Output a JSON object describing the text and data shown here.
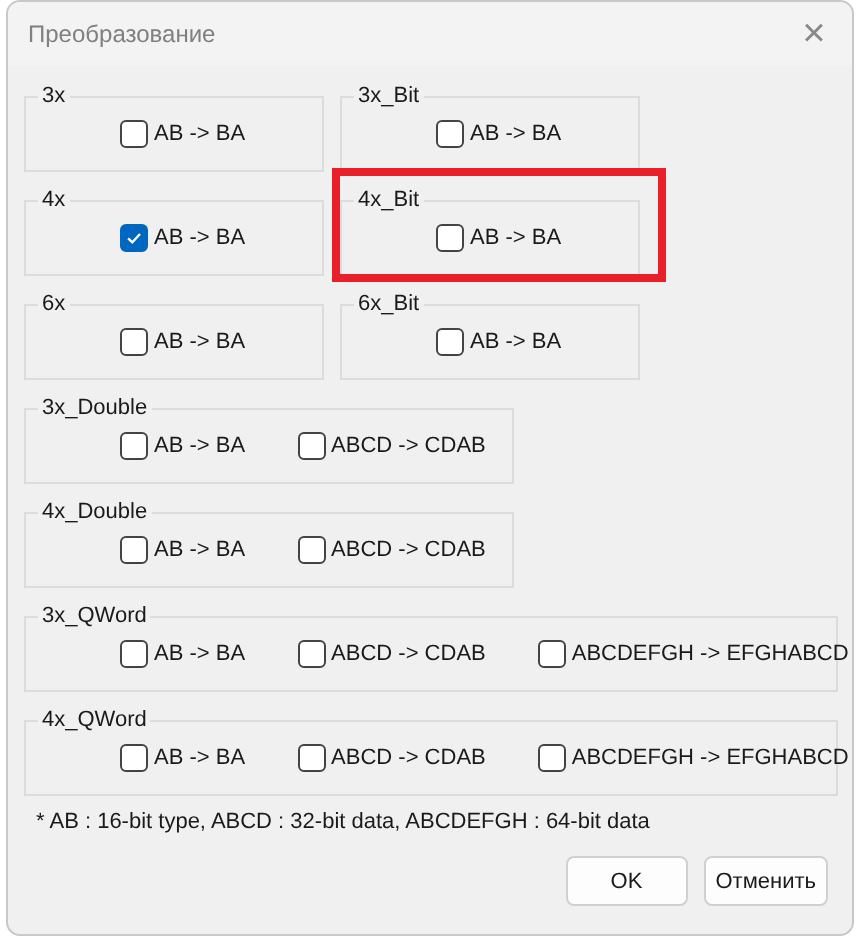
{
  "window": {
    "title": "Преобразование",
    "close": "×"
  },
  "rows": [
    {
      "groups": [
        {
          "label": "3x",
          "highlighted": false,
          "options": [
            {
              "label": "AB -> BA",
              "checked": false
            }
          ]
        },
        {
          "label": "3x_Bit",
          "highlighted": false,
          "options": [
            {
              "label": "AB -> BA",
              "checked": false
            }
          ]
        }
      ]
    },
    {
      "groups": [
        {
          "label": "4x",
          "highlighted": false,
          "options": [
            {
              "label": "AB -> BA",
              "checked": true
            }
          ]
        },
        {
          "label": "4x_Bit",
          "highlighted": true,
          "options": [
            {
              "label": "AB -> BA",
              "checked": false
            }
          ]
        }
      ]
    },
    {
      "groups": [
        {
          "label": "6x",
          "highlighted": false,
          "options": [
            {
              "label": "AB -> BA",
              "checked": false
            }
          ]
        },
        {
          "label": "6x_Bit",
          "highlighted": false,
          "options": [
            {
              "label": "AB -> BA",
              "checked": false
            }
          ]
        }
      ]
    },
    {
      "groups": [
        {
          "label": "3x_Double",
          "highlighted": false,
          "options": [
            {
              "label": "AB -> BA",
              "checked": false
            },
            {
              "label": "ABCD -> CDAB",
              "checked": false
            }
          ]
        }
      ]
    },
    {
      "groups": [
        {
          "label": "4x_Double",
          "highlighted": false,
          "options": [
            {
              "label": "AB -> BA",
              "checked": false
            },
            {
              "label": "ABCD -> CDAB",
              "checked": false
            }
          ]
        }
      ]
    },
    {
      "groups": [
        {
          "label": "3x_QWord",
          "highlighted": false,
          "options": [
            {
              "label": "AB -> BA",
              "checked": false
            },
            {
              "label": "ABCD -> CDAB",
              "checked": false
            },
            {
              "label": "ABCDEFGH -> EFGHABCD",
              "checked": false
            }
          ]
        }
      ]
    },
    {
      "groups": [
        {
          "label": "4x_QWord",
          "highlighted": false,
          "options": [
            {
              "label": "AB -> BA",
              "checked": false
            },
            {
              "label": "ABCD -> CDAB",
              "checked": false
            },
            {
              "label": "ABCDEFGH -> EFGHABCD",
              "checked": false
            }
          ]
        }
      ]
    }
  ],
  "footnote": "* AB : 16-bit type, ABCD : 32-bit data, ABCDEFGH : 64-bit data",
  "buttons": [
    "OK",
    "Отменить"
  ]
}
